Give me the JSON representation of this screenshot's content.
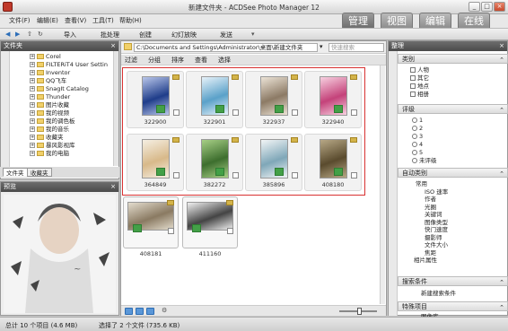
{
  "window": {
    "title": "新建文件夹 - ACDSee Photo Manager 12",
    "min": "_",
    "max": "□",
    "close": "×"
  },
  "menu": [
    "文件(F)",
    "编辑(E)",
    "查看(V)",
    "工具(T)",
    "帮助(H)"
  ],
  "modes": [
    "管理",
    "视图",
    "编辑",
    "在线"
  ],
  "toolbar": [
    "导入",
    "批处理",
    "创建",
    "幻灯放映",
    "发送"
  ],
  "left": {
    "header": "文件夹",
    "close": "×",
    "tree": [
      "Corel",
      "FILTERiT4 User Settin",
      "Inventor",
      "QQ飞车",
      "SnagIt Catalog",
      "Thunder",
      "图片收藏",
      "我的视频",
      "我的调色板",
      "我的音乐",
      "收藏夹",
      "暴风影视库",
      "我的电脑"
    ],
    "tabs": [
      "文件夹",
      "收藏夹"
    ],
    "preview_header": "预览"
  },
  "address": {
    "path": "C:\\Documents and Settings\\Administrator\\桌面\\新建文件夹",
    "search_placeholder": "快速搜索"
  },
  "filterbar": [
    "过滤",
    "分组",
    "排序",
    "查看",
    "选择"
  ],
  "thumbs": [
    {
      "label": "322900",
      "c1": "#1f3d8a",
      "c2": "#b9c6ea"
    },
    {
      "label": "322901",
      "c1": "#5aa1c9",
      "c2": "#e7f2f9"
    },
    {
      "label": "322937",
      "c1": "#8c7a65",
      "c2": "#ece3d6"
    },
    {
      "label": "322940",
      "c1": "#c4427a",
      "c2": "#f7d0e0"
    },
    {
      "label": "364849",
      "c1": "#d8b98a",
      "c2": "#f5efe3"
    },
    {
      "label": "382272",
      "c1": "#3d6e2e",
      "c2": "#a7cf86"
    },
    {
      "label": "385896",
      "c1": "#7fa7b8",
      "c2": "#f2f5f6"
    },
    {
      "label": "408180",
      "c1": "#5a4b2e",
      "c2": "#b7a886"
    },
    {
      "label": "408181",
      "c1": "#8a7a62",
      "c2": "#e3dccd"
    },
    {
      "label": "411160",
      "c1": "#444444",
      "c2": "#f0f0f0"
    }
  ],
  "right": {
    "header": "整理",
    "close": "×",
    "categories": {
      "title": "类别",
      "items": [
        "人物",
        "其它",
        "地点",
        "相册"
      ]
    },
    "ratings": {
      "title": "评级",
      "items": [
        "1",
        "2",
        "3",
        "4",
        "5",
        "未评级"
      ]
    },
    "auto": {
      "title": "自动类别",
      "items": [
        "常用",
        "ISO 速率",
        "作者",
        "光圈",
        "关键词",
        "图像类型",
        "快门速度",
        "摄影师",
        "文件大小",
        "焦距",
        "相片属性"
      ]
    },
    "saved": {
      "title": "搜索条件",
      "items": [
        "新建搜索条件"
      ]
    },
    "special": {
      "title": "特殊项目",
      "items": [
        "图像库"
      ]
    }
  },
  "status": {
    "left": "总计 10 个项目 (4.6 MB)",
    "right": "选择了 2 个文件 (735.6 KB)"
  },
  "colors": {
    "selection": "#d83131",
    "tag": "#43a047"
  }
}
